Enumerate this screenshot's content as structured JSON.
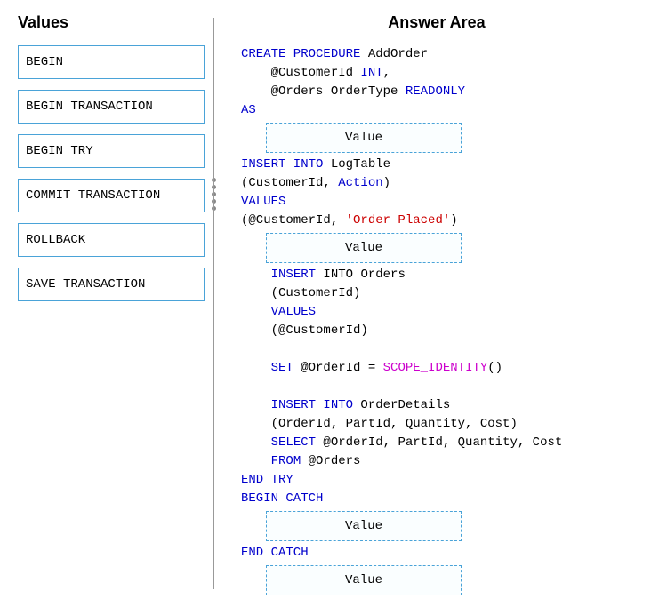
{
  "values": {
    "heading": "Values",
    "items": [
      "BEGIN",
      "BEGIN TRANSACTION",
      "BEGIN TRY",
      "COMMIT TRANSACTION",
      "ROLLBACK",
      "SAVE TRANSACTION"
    ]
  },
  "answer": {
    "heading": "Answer Area",
    "dropzone_placeholder": "Value",
    "code": {
      "l1a": "CREATE PROCEDURE",
      "l1b": " AddOrder",
      "l2a": "    @CustomerId ",
      "l2b": "INT",
      "l2c": ",",
      "l3a": "    @Orders OrderType ",
      "l3b": "READONLY",
      "l4": "AS",
      "l5a": "INSERT INTO",
      "l5b": " LogTable",
      "l6a": "(CustomerId, ",
      "l6b": "Action",
      "l6c": ")",
      "l7": "VALUES",
      "l8a": "(@CustomerId, ",
      "l8b": "'Order Placed'",
      "l8c": ")",
      "l9a": "    ",
      "l9b": "INSERT",
      "l9c": " INTO Orders",
      "l10": "    (CustomerId)",
      "l11a": "    ",
      "l11b": "VALUES",
      "l12": "    (@CustomerId)",
      "l13a": "    ",
      "l13b": "SET",
      "l13c": " @OrderId = ",
      "l13d": "SCOPE_IDENTITY",
      "l13e": "()",
      "l14a": "    ",
      "l14b": "INSERT INTO",
      "l14c": " OrderDetails",
      "l15": "    (OrderId, PartId, Quantity, Cost)",
      "l16a": "    ",
      "l16b": "SELECT",
      "l16c": " @OrderId, PartId, Quantity, Cost",
      "l17a": "    ",
      "l17b": "FROM",
      "l17c": " @Orders",
      "l18": "END TRY",
      "l19": "BEGIN CATCH",
      "l20": "END CATCH"
    }
  }
}
